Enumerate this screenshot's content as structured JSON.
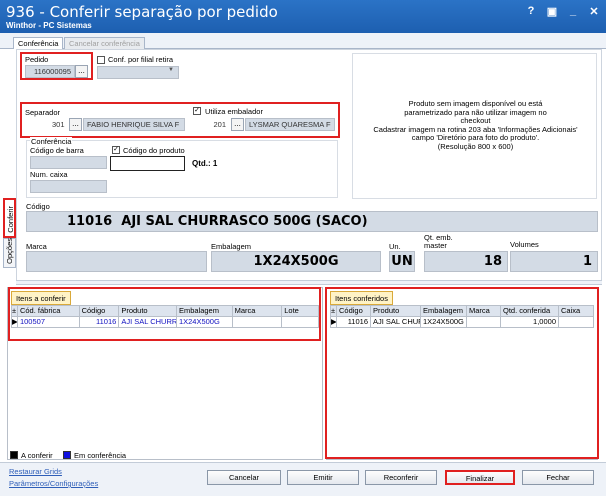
{
  "window": {
    "title": "936 - Conferir separação por pedido",
    "subtitle": "Winthor - PC Sistemas",
    "controls": [
      "?",
      "▣",
      "_",
      "✕"
    ]
  },
  "tabs": [
    {
      "label": "Conferência",
      "state": "active"
    },
    {
      "label": "Cancelar conferência",
      "state": "disabled"
    }
  ],
  "side_tabs": {
    "conferir": "Conferir",
    "opcoes": "Opções"
  },
  "pedido": {
    "label": "Pedido",
    "value": "116000095",
    "button": "..."
  },
  "conf_filial": {
    "label": "Conf. por filial retira",
    "checked": false
  },
  "separador": {
    "label": "Separador",
    "code": "301",
    "name": "FABIO HENRIQUE SILVA F",
    "button": "..."
  },
  "embalador": {
    "label": "Utiliza embalador",
    "checked": true,
    "code": "201",
    "name": "LYSMAR QUARESMA F",
    "button": "..."
  },
  "conferencia": {
    "group_label": "Conferência",
    "codigo_barra_label": "Código de barra",
    "codigo_produto_label": "Código do produto",
    "codigo_produto_checked": true,
    "qtd_label": "Qtd.: 1",
    "num_caixa_label": "Num. caixa"
  },
  "image_message": [
    "Produto sem imagem disponível ou está",
    "parametrizado para não utilizar imagem no",
    "checkout",
    "Cadastrar imagem na rotina 203 aba 'Informações Adicionais'",
    "campo 'Diretório para foto do produto'.",
    "(Resolução 800 x 600)"
  ],
  "codigo": {
    "label": "Código",
    "value": "11016  AJI SAL CHURRASCO 500G (SACO)"
  },
  "product_info": {
    "marca_label": "Marca",
    "marca_value": "",
    "embalagem_label": "Embalagem",
    "embalagem_value": "1X24X500G",
    "un_label": "Un.",
    "un_value": "UN",
    "qt_emb_label_1": "Qt. emb.",
    "qt_emb_label_2": "master",
    "qt_emb_value": "18",
    "volumes_label": "Volumes",
    "volumes_value": "1"
  },
  "itens_a_conferir": {
    "tab": "Itens a conferir",
    "columns": [
      "Cód. fábrica",
      "Código",
      "Produto",
      "Embalagem",
      "Marca",
      "Lote"
    ],
    "rows": [
      [
        "100507",
        "11016",
        "AJI SAL CHURRA",
        "1X24X500G",
        "",
        ""
      ]
    ]
  },
  "itens_conferidos": {
    "tab": "Itens conferidos",
    "columns": [
      "Código",
      "Produto",
      "Embalagem",
      "Marca",
      "Qtd. conferida",
      "Caixa"
    ],
    "rows": [
      [
        "11016",
        "AJI SAL CHUR",
        "1X24X500G",
        "",
        "1,0000",
        ""
      ]
    ]
  },
  "legend": [
    {
      "label": "A conferir",
      "color": "#000000"
    },
    {
      "label": "Em conferência",
      "color": "#1010e0"
    }
  ],
  "links": {
    "restaurar": "Restaurar Grids",
    "parametros": "Parâmetros/Configurações"
  },
  "buttons": {
    "cancelar": "Cancelar",
    "emitir": "Emitir",
    "reconferir": "Reconferir",
    "finalizar": "Finalizar",
    "fechar": "Fechar"
  },
  "colors": {
    "titlebar": "#2b73c6",
    "highlight_red": "#e02020",
    "grid_tab": "#fff3c6",
    "field_bg": "#d3dbe5"
  }
}
